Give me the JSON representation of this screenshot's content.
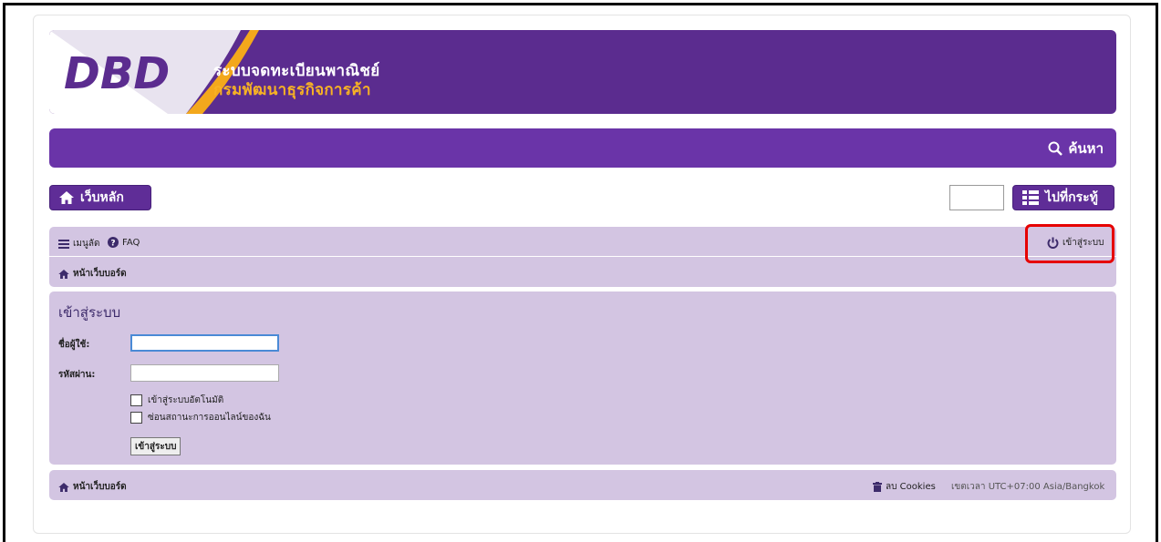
{
  "header": {
    "logo_text": "DBD",
    "title_line1": "ระบบจดทะเบียนพาณิชย์",
    "title_line2": "กรมพัฒนาธุรกิจการค้า"
  },
  "navbar": {
    "search_label": "ค้นหา"
  },
  "toolbar": {
    "home_label": "เว็บหลัก",
    "jump_label": "ไปที่กระทู้",
    "jump_input_value": ""
  },
  "topbar": {
    "menu_label": "เมนูลัด",
    "faq_label": "FAQ",
    "login_label": "เข้าสู่ระบบ",
    "breadcrumb": "หน้าเว็บบอร์ด"
  },
  "login_panel": {
    "title": "เข้าสู่ระบบ",
    "username_label": "ชื่อผู้ใช้:",
    "username_value": "",
    "password_label": "รหัสผ่าน:",
    "password_value": "",
    "remember_label": "เข้าสู่ระบบอัตโนมัติ",
    "hide_online_label": "ซ่อนสถานะการออนไลน์ของฉัน",
    "submit_label": "เข้าสู่ระบบ"
  },
  "footer": {
    "breadcrumb": "หน้าเว็บบอร์ด",
    "cookies_label": "ลบ Cookies",
    "timezone": "เขตเวลา UTC+07:00 Asia/Bangkok"
  },
  "colors": {
    "brand_purple": "#5b2c8f",
    "bar_light": "#d3c5e2",
    "highlight": "#e60000"
  }
}
